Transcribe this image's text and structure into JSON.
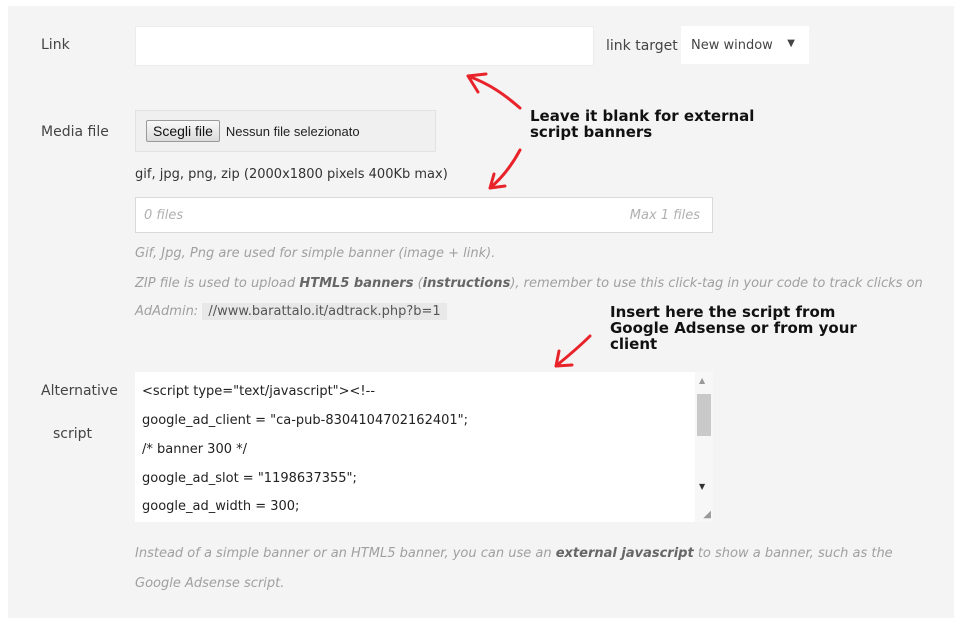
{
  "link": {
    "label": "Link",
    "value": "",
    "target_label": "link target",
    "target_value": "New window"
  },
  "media": {
    "label": "Media file",
    "button_label": "Scegli file",
    "no_file_text": "Nessun file selezionato",
    "formats_text": "gif, jpg, png, zip (2000x1800 pixels 400Kb max)",
    "files_count": "0 files",
    "files_max": "Max 1 files",
    "help1": "Gif, Jpg, Png are used for simple banner (image + link).",
    "help2_pre": "ZIP file is used to upload ",
    "help2_bold": "HTML5 banners",
    "help2_mid": " (",
    "help2_link": "instructions",
    "help2_post": "), remember to use this click-tag in your code to track clicks on",
    "help3_pre": "AdAdmin:",
    "tracking_url": "//www.barattalo.it/adtrack.php?b=1"
  },
  "alt_script": {
    "label_line1": "Alternative",
    "label_line2": "script",
    "lines": [
      "<script type=\"text/javascript\"><!--",
      "google_ad_client = \"ca-pub-8304104702162401\";",
      "/* banner 300 */",
      "google_ad_slot = \"1198637355\";",
      "google_ad_width = 300;"
    ],
    "help_pre": "Instead of a simple banner or an HTML5 banner, you can use an ",
    "help_bold": "external javascript",
    "help_post": " to show a banner, such as the",
    "help_line2": "Google Adsense script."
  },
  "annotations": {
    "blank_line1": "Leave it blank for external",
    "blank_line2": "script banners",
    "script_line1": "Insert here the script from",
    "script_line2": "Google Adsense or from your",
    "script_line3": "client"
  },
  "colors": {
    "arrow": "#e8232a",
    "panel": "#f4f4f4"
  },
  "icons": {
    "select_caret": "caret-down-icon",
    "scroll_up": "scroll-up-icon",
    "scroll_down": "scroll-down-icon",
    "resize": "resize-handle-icon"
  }
}
